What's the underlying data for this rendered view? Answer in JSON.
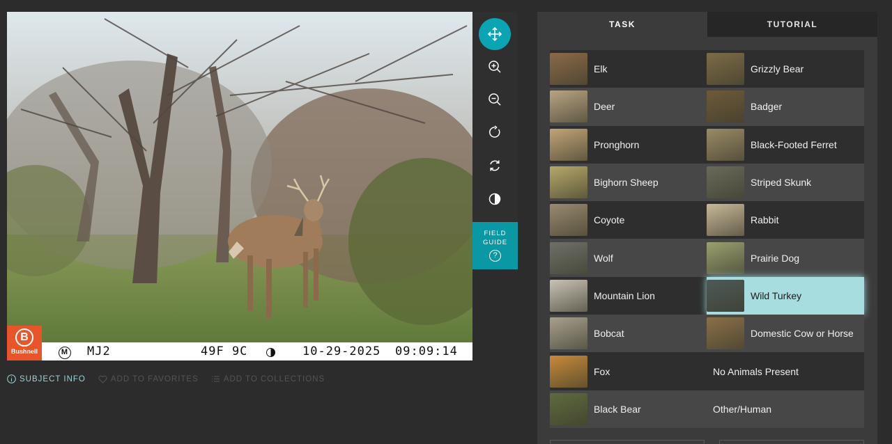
{
  "photo_stamp": {
    "brand": "Bushnell",
    "brand_letter": "B",
    "mode_letter": "M",
    "camera_id": "MJ2",
    "temperature": "49F 9C",
    "date": "10-29-2025",
    "time": "09:09:14"
  },
  "tools": {
    "field_guide_line1": "FIELD",
    "field_guide_line2": "GUIDE",
    "help_glyph": "?"
  },
  "meta_links": {
    "subject_info": "SUBJECT INFO",
    "add_to_favorites": "ADD TO FAVORITES",
    "add_to_collections": "ADD TO COLLECTIONS"
  },
  "tabs": [
    {
      "label": "TASK",
      "active": true
    },
    {
      "label": "TUTORIAL",
      "active": false
    }
  ],
  "choices": [
    {
      "label": "Elk",
      "icon": "elk-thumb",
      "color": "#8a6a48"
    },
    {
      "label": "Grizzly Bear",
      "icon": "grizzly-bear-thumb",
      "color": "#7d6b47"
    },
    {
      "label": "Deer",
      "icon": "deer-thumb",
      "color": "#b9a483"
    },
    {
      "label": "Badger",
      "icon": "badger-thumb",
      "color": "#6e5a3a"
    },
    {
      "label": "Pronghorn",
      "icon": "pronghorn-thumb",
      "color": "#c2a477"
    },
    {
      "label": "Black-Footed Ferret",
      "icon": "ferret-thumb",
      "color": "#9a8a66"
    },
    {
      "label": "Bighorn Sheep",
      "icon": "bighorn-sheep-thumb",
      "color": "#b7a86a"
    },
    {
      "label": "Striped Skunk",
      "icon": "skunk-thumb",
      "color": "#6a6a5a"
    },
    {
      "label": "Coyote",
      "icon": "coyote-thumb",
      "color": "#9a8a70"
    },
    {
      "label": "Rabbit",
      "icon": "rabbit-thumb",
      "color": "#c8b898"
    },
    {
      "label": "Wolf",
      "icon": "wolf-thumb",
      "color": "#6e7068"
    },
    {
      "label": "Prairie Dog",
      "icon": "prairie-dog-thumb",
      "color": "#9aa070"
    },
    {
      "label": "Mountain Lion",
      "icon": "mountain-lion-thumb",
      "color": "#c9c2b4"
    },
    {
      "label": "Wild Turkey",
      "icon": "wild-turkey-thumb",
      "color": "#4d5a58",
      "selected": true
    },
    {
      "label": "Bobcat",
      "icon": "bobcat-thumb",
      "color": "#a8a08e"
    },
    {
      "label": "Domestic Cow or Horse",
      "icon": "cow-horse-thumb",
      "color": "#8a7048"
    },
    {
      "label": "Fox",
      "icon": "fox-thumb",
      "color": "#c88a3a"
    },
    {
      "label": "No Animals Present",
      "icon": "",
      "color": ""
    },
    {
      "label": "Black Bear",
      "icon": "black-bear-thumb",
      "color": "#5e6a3e"
    },
    {
      "label": "Other/Human",
      "icon": "",
      "color": ""
    }
  ],
  "colors": {
    "accent": "#0aa5b3",
    "selected": "#a8dde0",
    "brand_orange": "#e8552a"
  }
}
